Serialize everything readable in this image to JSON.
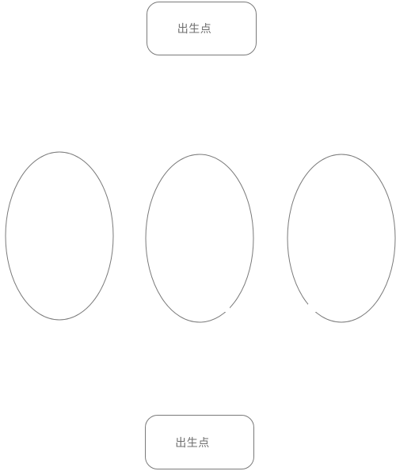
{
  "diagram": {
    "spawn_top": {
      "label": "出生点"
    },
    "spawn_bottom": {
      "label": "出生点"
    },
    "ellipses": [
      {
        "id": "left-ellipse"
      },
      {
        "id": "center-ellipse"
      },
      {
        "id": "right-ellipse"
      }
    ],
    "colors": {
      "stroke": "#7a7a7a",
      "text": "#6e6e6e",
      "background": "#ffffff"
    }
  }
}
